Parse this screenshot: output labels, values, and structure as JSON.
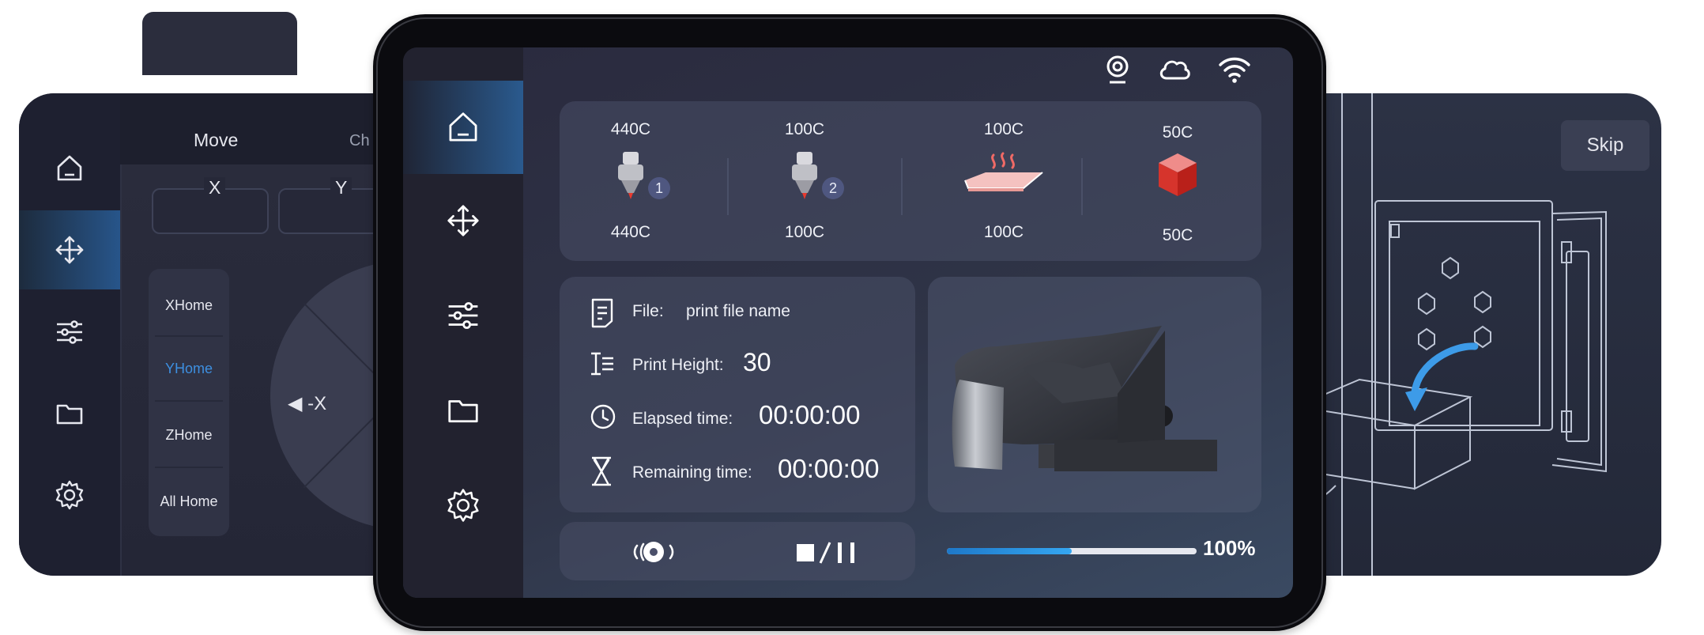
{
  "left_panel": {
    "nav": [
      {
        "icon": "home-icon"
      },
      {
        "icon": "move-icon",
        "active": true
      },
      {
        "icon": "sliders-icon"
      },
      {
        "icon": "folder-icon"
      },
      {
        "icon": "gear-icon"
      }
    ],
    "tabs": [
      "Move",
      "Ch"
    ],
    "axes": [
      "X",
      "Y"
    ],
    "home_buttons": [
      "XHome",
      "YHome",
      "ZHome",
      "All Home"
    ],
    "active_home": "YHome",
    "dial_label": "◀ -X"
  },
  "screen": {
    "status_icons": [
      "camera-icon",
      "cloud-icon",
      "wifi-icon"
    ],
    "nav": [
      {
        "icon": "home-icon",
        "active": true
      },
      {
        "icon": "move-icon"
      },
      {
        "icon": "sliders-icon"
      },
      {
        "icon": "folder-icon"
      },
      {
        "icon": "gear-icon"
      }
    ],
    "temperatures": [
      {
        "name": "extruder-1",
        "current": "440C",
        "target": "440C",
        "badge": "1"
      },
      {
        "name": "extruder-2",
        "current": "100C",
        "target": "100C",
        "badge": "2"
      },
      {
        "name": "heated-bed",
        "current": "100C",
        "target": "100C"
      },
      {
        "name": "chamber",
        "current": "50C",
        "target": "50C"
      }
    ],
    "file": {
      "label": "File:",
      "value": "print file name"
    },
    "print_height": {
      "label": "Print Height:",
      "value": "30"
    },
    "elapsed": {
      "label": "Elapsed time:",
      "value": "00:00:00"
    },
    "remaining": {
      "label": "Remaining time:",
      "value": "00:00:00"
    },
    "progress": {
      "percent": 0.5,
      "label": "100%"
    },
    "colors": {
      "accent": "#2a8be0",
      "progress": "#35a7f2"
    }
  },
  "right_panel": {
    "skip_label": "Skip"
  }
}
